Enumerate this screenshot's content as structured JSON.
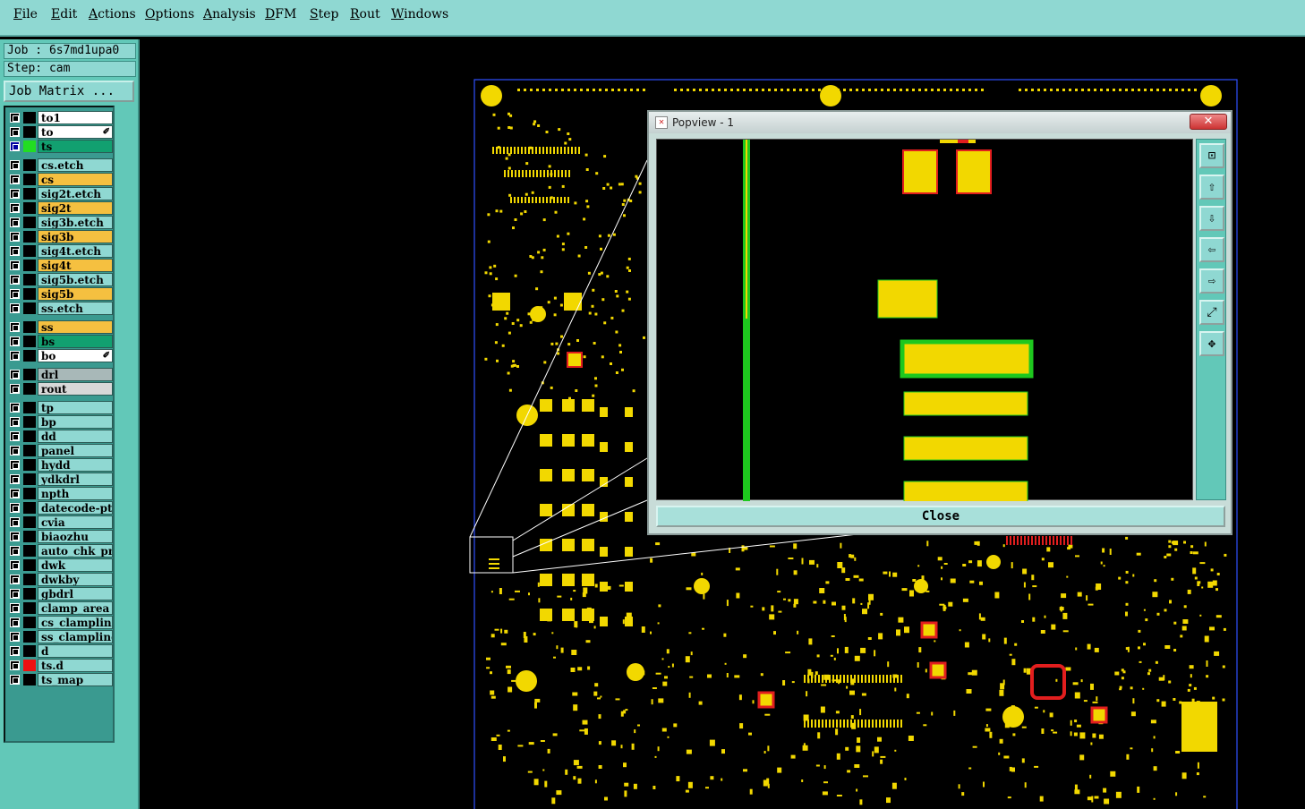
{
  "menubar": {
    "items": [
      {
        "label": "File"
      },
      {
        "label": "Edit"
      },
      {
        "label": "Actions"
      },
      {
        "label": "Options"
      },
      {
        "label": "Analysis"
      },
      {
        "label": "DFM"
      },
      {
        "label": "Step"
      },
      {
        "label": "Rout"
      },
      {
        "label": "Windows"
      }
    ]
  },
  "job": {
    "job_label": "Job : 6s7md1upa0",
    "step_label": "Step: cam",
    "matrix_button": "Job Matrix ..."
  },
  "layers": [
    {
      "name": "to1",
      "bg": "#ffffff",
      "color": "#000000"
    },
    {
      "name": "to",
      "bg": "#ffffff",
      "color": "#000000",
      "mark": "✐"
    },
    {
      "name": "ts",
      "bg": "#12a070",
      "color": "#22dd22",
      "selected": true
    },
    {
      "name": "cs.etch",
      "bg": "#8fd8d2",
      "color": "#000000"
    },
    {
      "name": "cs",
      "bg": "#f5c040",
      "color": "#000000"
    },
    {
      "name": "sig2t.etch",
      "bg": "#8fd8d2",
      "color": "#000000"
    },
    {
      "name": "sig2t",
      "bg": "#f5c040",
      "color": "#000000"
    },
    {
      "name": "sig3b.etch",
      "bg": "#8fd8d2",
      "color": "#000000"
    },
    {
      "name": "sig3b",
      "bg": "#f5c040",
      "color": "#000000"
    },
    {
      "name": "sig4t.etch",
      "bg": "#8fd8d2",
      "color": "#000000"
    },
    {
      "name": "sig4t",
      "bg": "#f5c040",
      "color": "#000000"
    },
    {
      "name": "sig5b.etch",
      "bg": "#8fd8d2",
      "color": "#000000"
    },
    {
      "name": "sig5b",
      "bg": "#f5c040",
      "color": "#000000"
    },
    {
      "name": "ss.etch",
      "bg": "#8fd8d2",
      "color": "#000000"
    },
    {
      "name": "ss",
      "bg": "#f5c040",
      "color": "#000000"
    },
    {
      "name": "bs",
      "bg": "#12a070",
      "color": "#000000"
    },
    {
      "name": "bo",
      "bg": "#ffffff",
      "color": "#000000",
      "mark": "✐"
    },
    {
      "name": "drl",
      "bg": "#a8b8b8",
      "color": "#000000"
    },
    {
      "name": "rout",
      "bg": "#d8d8d8",
      "color": "#000000"
    },
    {
      "name": "tp",
      "bg": "#8fd8d2",
      "color": "#000000"
    },
    {
      "name": "bp",
      "bg": "#8fd8d2",
      "color": "#000000"
    },
    {
      "name": "dd",
      "bg": "#8fd8d2",
      "color": "#000000"
    },
    {
      "name": "panel",
      "bg": "#8fd8d2",
      "color": "#000000"
    },
    {
      "name": "hydd",
      "bg": "#8fd8d2",
      "color": "#000000"
    },
    {
      "name": "ydkdrl",
      "bg": "#8fd8d2",
      "color": "#000000"
    },
    {
      "name": "npth",
      "bg": "#8fd8d2",
      "color": "#000000"
    },
    {
      "name": "datecode-ptd",
      "bg": "#8fd8d2",
      "color": "#000000"
    },
    {
      "name": "cvia",
      "bg": "#8fd8d2",
      "color": "#000000"
    },
    {
      "name": "biaozhu",
      "bg": "#8fd8d2",
      "color": "#000000"
    },
    {
      "name": "auto_chk_pnl",
      "bg": "#8fd8d2",
      "color": "#000000"
    },
    {
      "name": "dwk",
      "bg": "#8fd8d2",
      "color": "#000000"
    },
    {
      "name": "dwkby",
      "bg": "#8fd8d2",
      "color": "#000000"
    },
    {
      "name": "gbdrl",
      "bg": "#8fd8d2",
      "color": "#000000"
    },
    {
      "name": "clamp_area",
      "bg": "#8fd8d2",
      "color": "#000000"
    },
    {
      "name": "cs_clampline",
      "bg": "#8fd8d2",
      "color": "#000000"
    },
    {
      "name": "ss_clampline",
      "bg": "#8fd8d2",
      "color": "#000000"
    },
    {
      "name": "d",
      "bg": "#8fd8d2",
      "color": "#000000"
    },
    {
      "name": "ts.d",
      "bg": "#8fd8d2",
      "color": "#ee1111"
    },
    {
      "name": "ts_map",
      "bg": "#8fd8d2",
      "color": "#000000"
    }
  ],
  "popview": {
    "title": "Popview - 1",
    "close_x": "✕",
    "close_button": "Close",
    "tools": [
      {
        "icon": "zoom-window-icon",
        "glyph": "⊡"
      },
      {
        "icon": "pan-up-icon",
        "glyph": "⇧"
      },
      {
        "icon": "pan-down-icon",
        "glyph": "⇩"
      },
      {
        "icon": "pan-left-icon",
        "glyph": "⇦"
      },
      {
        "icon": "pan-right-icon",
        "glyph": "⇨"
      },
      {
        "icon": "zoom-home-icon",
        "glyph": "⤢"
      },
      {
        "icon": "fit-all-icon",
        "glyph": "✥"
      }
    ]
  },
  "colors": {
    "pad": "#f2d800",
    "pad_outline_red": "#e21e1e",
    "pad_outline_green": "#1ec81e",
    "panel_bg": "#62c8b8",
    "menu_bg": "#8fd8d2"
  }
}
